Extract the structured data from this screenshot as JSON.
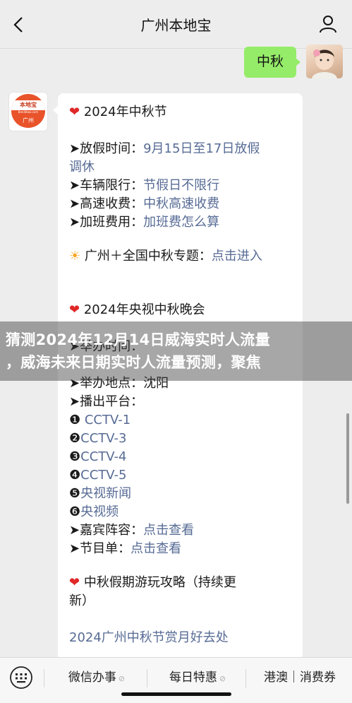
{
  "header": {
    "title": "广州本地宝",
    "back_icon": "chevron-left-icon",
    "user_icon": "person-icon"
  },
  "chat": {
    "user_message": "中秋",
    "bot_avatar": {
      "brand": "本地宝",
      "subtext": "Bendibao.com",
      "city": "广州"
    },
    "bot_message": {
      "s1_title": "2024年中秋节",
      "s1_items": {
        "holiday_label": "➤放假时间：",
        "holiday_value_1": "9月15日至17日放假",
        "holiday_value_2": "调休",
        "traffic_label": "➤车辆限行：",
        "traffic_value": "节假日不限行",
        "toll_label": "➤高速收费：",
        "toll_value": "中秋高速收费",
        "overtime_label": "➤加班费用：",
        "overtime_value": "加班费怎么算"
      },
      "topic_label": "广州＋全国中秋专题：",
      "topic_link": "点击进入",
      "s2_title": "2024年央视中秋晚会",
      "s2_time_label": "➤举办时间：",
      "s2_items": {
        "venue_label": "➤举办地点：",
        "venue_value": "沈阳",
        "platform_label": "➤播出平台：",
        "platforms": [
          {
            "num": "❶ ",
            "name": "CCTV-1"
          },
          {
            "num": "❷",
            "name": "CCTV-3"
          },
          {
            "num": "❸",
            "name": "CCTV-4"
          },
          {
            "num": "❹",
            "name": "CCTV-5"
          },
          {
            "num": "❺",
            "name": "央视新闻"
          },
          {
            "num": "❻",
            "name": "央视频"
          }
        ],
        "guests_label": "➤嘉宾阵容：",
        "guests_link": "点击查看",
        "program_label": "➤节目单：",
        "program_link": "点击查看"
      },
      "s3_title_1": "中秋假期游玩攻略（持续更",
      "s3_title_2": "新）",
      "s3_link": "2024广州中秋节赏月好去处"
    }
  },
  "overlay": {
    "headline_1": "猜测2024年12月14日威海实时人流量",
    "headline_2": "，威海未来日期实时人流量预测，聚焦"
  },
  "bottom_menu": {
    "keyboard_icon": "keyboard-icon",
    "items": [
      {
        "label": "微信办事"
      },
      {
        "label": "每日特惠"
      },
      {
        "label": "港澳｜消费券"
      }
    ]
  },
  "colors": {
    "link": "#576b95",
    "user_bubble": "#95ec69",
    "heart": "#e02828"
  }
}
